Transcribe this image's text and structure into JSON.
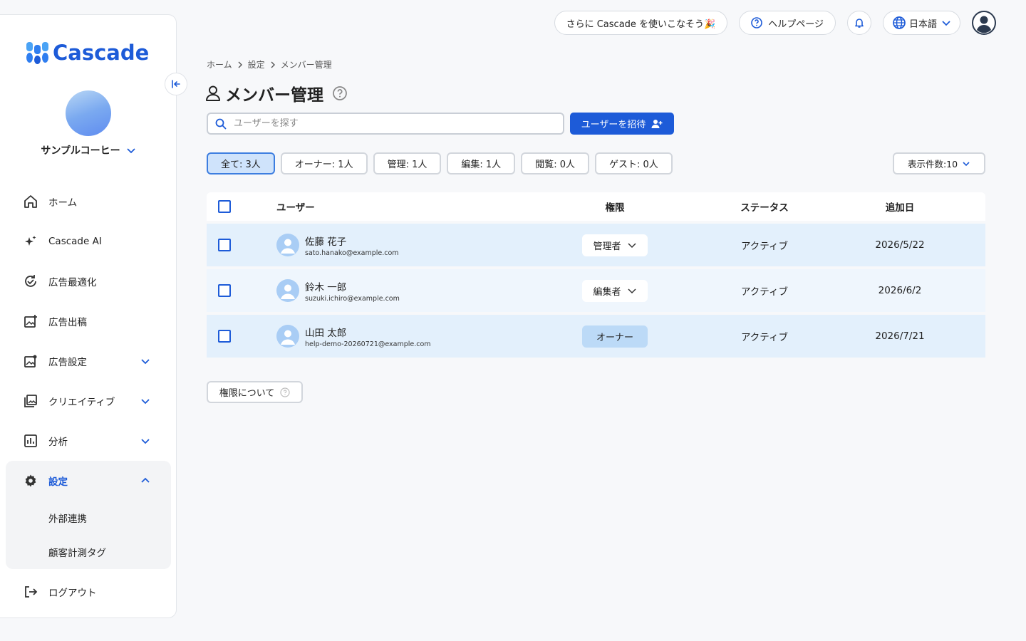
{
  "brand": {
    "name": "Cascade",
    "accent": "#1d5bd8"
  },
  "topbar": {
    "promo": "さらに Cascade を使いこなそう🎉",
    "help": "ヘルプページ",
    "language": "日本語"
  },
  "sidebar": {
    "company": "サンプルコーヒー",
    "items": [
      {
        "label": "ホーム",
        "icon": "home-icon"
      },
      {
        "label": "Cascade AI",
        "icon": "sparkle-icon"
      },
      {
        "label": "広告最適化",
        "icon": "refresh-check-icon"
      },
      {
        "label": "広告出稿",
        "icon": "image-add-icon"
      },
      {
        "label": "広告設定",
        "icon": "image-gear-icon"
      },
      {
        "label": "クリエイティブ",
        "icon": "gallery-icon"
      },
      {
        "label": "分析",
        "icon": "chart-icon"
      }
    ],
    "settings": {
      "label": "設定",
      "sub": [
        "外部連携",
        "顧客計測タグ"
      ]
    },
    "logout": "ログアウト"
  },
  "breadcrumb": [
    "ホーム",
    "設定",
    "メンバー管理"
  ],
  "page": {
    "title": "メンバー管理",
    "search_placeholder": "ユーザーを探す",
    "invite": "ユーザーを招待",
    "per_page": "表示件数:10",
    "perm_info": "権限について"
  },
  "filters": [
    "全て: 3人",
    "オーナー: 1人",
    "管理: 1人",
    "編集: 1人",
    "閲覧: 0人",
    "ゲスト: 0人"
  ],
  "table": {
    "headers": {
      "user": "ユーザー",
      "role": "権限",
      "status": "ステータス",
      "date": "追加日"
    },
    "rows": [
      {
        "name": "佐藤 花子",
        "email": "sato.hanako@example.com",
        "role": "管理者",
        "status": "アクティブ",
        "date": "2026/5/22"
      },
      {
        "name": "鈴木 一郎",
        "email": "suzuki.ichiro@example.com",
        "role": "編集者",
        "status": "アクティブ",
        "date": "2026/6/2"
      },
      {
        "name": "山田 太郎",
        "email": "help-demo-20260721@example.com",
        "role": "オーナー",
        "status": "アクティブ",
        "date": "2026/7/21"
      }
    ]
  }
}
